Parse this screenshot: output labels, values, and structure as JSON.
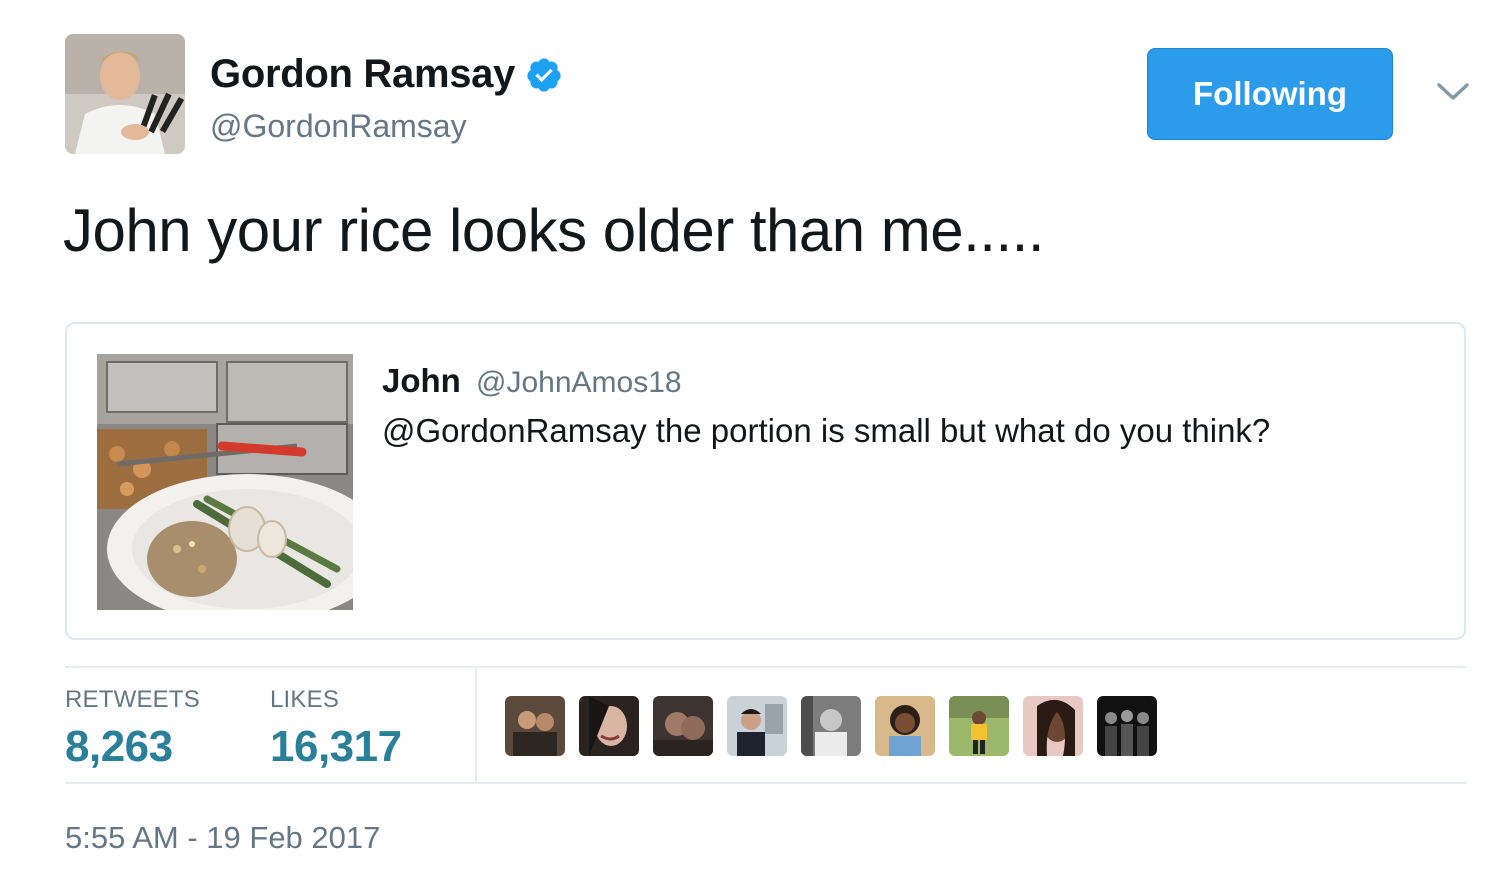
{
  "author": {
    "display_name": "Gordon Ramsay",
    "handle": "@GordonRamsay",
    "verified": true
  },
  "follow_button": {
    "label": "Following"
  },
  "tweet": {
    "text": "John your rice looks older than me....."
  },
  "quoted_tweet": {
    "name": "John",
    "handle": "@JohnAmos18",
    "text": "@GordonRamsay the portion is small but what do you think?"
  },
  "stats": {
    "retweets_label": "RETWEETS",
    "retweets_value": "8,263",
    "likes_label": "LIKES",
    "likes_value": "16,317"
  },
  "timestamp": "5:55 AM - 19 Feb 2017",
  "colors": {
    "button_blue": "#2b9bea",
    "stat_teal": "#2a7f99",
    "muted_gray": "#657786",
    "verified_blue": "#1da1f2"
  }
}
